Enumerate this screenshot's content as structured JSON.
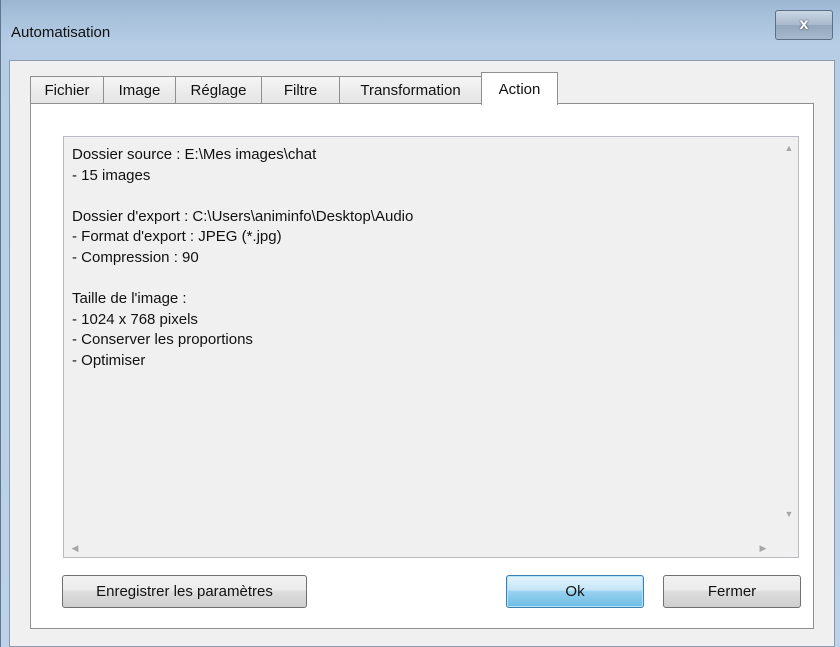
{
  "window": {
    "title": "Automatisation",
    "close_label": "x"
  },
  "tabs": [
    {
      "label": "Fichier",
      "active": false
    },
    {
      "label": "Image",
      "active": false
    },
    {
      "label": "Réglage",
      "active": false
    },
    {
      "label": "Filtre",
      "active": false
    },
    {
      "label": "Transformation",
      "active": false
    },
    {
      "label": "Action",
      "active": true
    }
  ],
  "summary": {
    "lines": [
      "Dossier source : E:\\Mes images\\chat",
      "- 15 images",
      "",
      "Dossier d'export : C:\\Users\\animinfo\\Desktop\\Audio",
      "- Format d'export : JPEG (*.jpg)",
      "- Compression : 90",
      "",
      "Taille de l'image :",
      "- 1024 x 768 pixels",
      "- Conserver les proportions",
      "- Optimiser"
    ]
  },
  "buttons": {
    "save_settings": "Enregistrer les paramètres",
    "ok": "Ok",
    "close": "Fermer"
  },
  "scroll_glyphs": {
    "up": "▲",
    "down": "▼",
    "left": "◀",
    "right": "▶"
  }
}
